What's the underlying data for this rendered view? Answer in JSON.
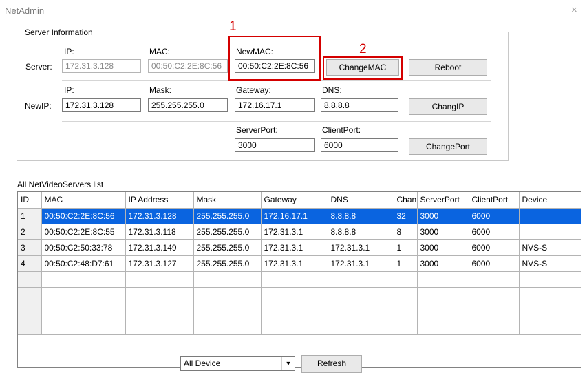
{
  "window": {
    "title": "NetAdmin",
    "close_glyph": "×"
  },
  "server_info": {
    "legend": "Server Information",
    "server_row": {
      "label": "Server:",
      "ip_label": "IP:",
      "ip_value": "172.31.3.128",
      "mac_label": "MAC:",
      "mac_value": "00:50:C2:2E:8C:56",
      "newmac_label": "NewMAC:",
      "newmac_value": "00:50:C2:2E:8C:56",
      "change_mac_button": "ChangeMAC",
      "reboot_button": "Reboot"
    },
    "newip_row": {
      "label": "NewIP:",
      "ip_label": "IP:",
      "ip_value": "172.31.3.128",
      "mask_label": "Mask:",
      "mask_value": "255.255.255.0",
      "gateway_label": "Gateway:",
      "gateway_value": "172.16.17.1",
      "dns_label": "DNS:",
      "dns_value": "8.8.8.8",
      "chang_ip_button": "ChangIP"
    },
    "port_row": {
      "server_port_label": "ServerPort:",
      "server_port_value": "3000",
      "client_port_label": "ClientPort:",
      "client_port_value": "6000",
      "change_port_button": "ChangePort"
    }
  },
  "annotations": {
    "one": "1",
    "two": "2",
    "color": "#d40000"
  },
  "servers_list": {
    "label": "All NetVideoServers list",
    "columns": [
      "ID",
      "MAC",
      "IP Address",
      "Mask",
      "Gateway",
      "DNS",
      "Chan",
      "ServerPort",
      "ClientPort",
      "Device"
    ],
    "rows": [
      [
        "1",
        "00:50:C2:2E:8C:56",
        "172.31.3.128",
        "255.255.255.0",
        "172.16.17.1",
        "8.8.8.8",
        "32",
        "3000",
        "6000",
        ""
      ],
      [
        "2",
        "00:50:C2:2E:8C:55",
        "172.31.3.118",
        "255.255.255.0",
        "172.31.3.1",
        "8.8.8.8",
        "8",
        "3000",
        "6000",
        ""
      ],
      [
        "3",
        "00:50:C2:50:33:78",
        "172.31.3.149",
        "255.255.255.0",
        "172.31.3.1",
        "172.31.3.1",
        "1",
        "3000",
        "6000",
        "NVS-S"
      ],
      [
        "4",
        "00:50:C2:48:D7:61",
        "172.31.3.127",
        "255.255.255.0",
        "172.31.3.1",
        "172.31.3.1",
        "1",
        "3000",
        "6000",
        "NVS-S"
      ]
    ],
    "selected_row": 0,
    "selection_color": "#0a64e0",
    "empty_rows": 4
  },
  "bottom": {
    "filter_value": "All Device",
    "refresh_button": "Refresh"
  }
}
